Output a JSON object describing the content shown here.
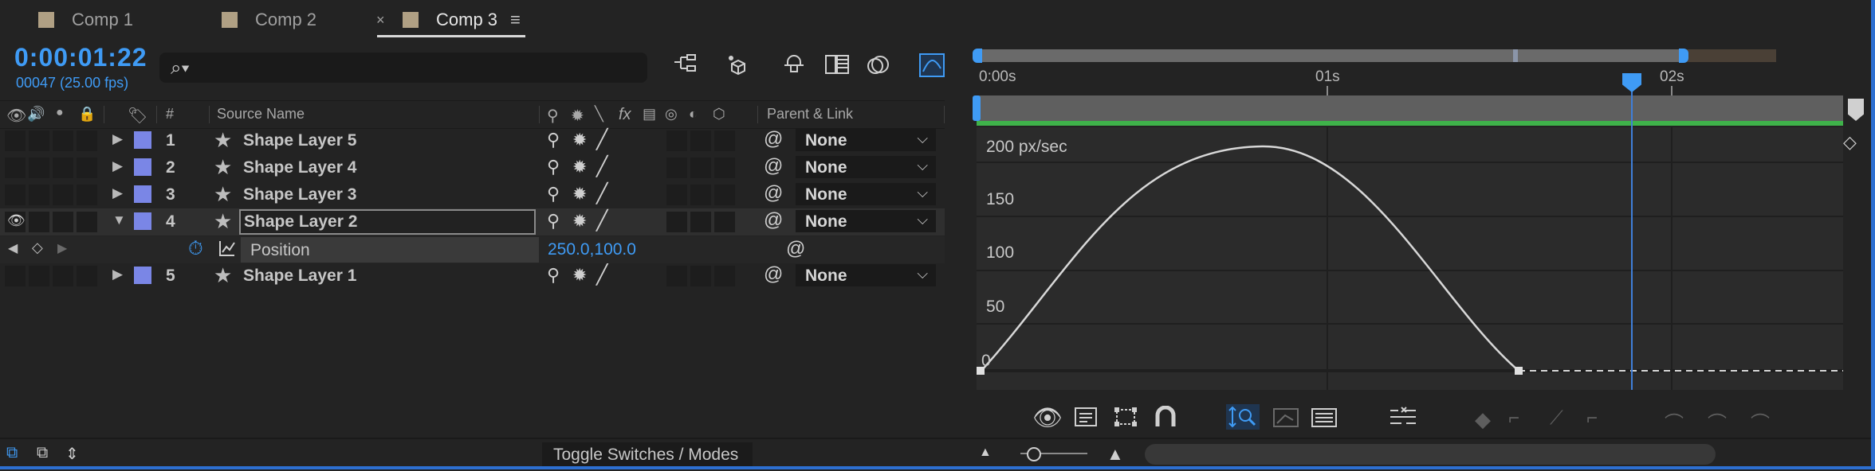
{
  "tabs": [
    {
      "label": "Comp 1",
      "active": false
    },
    {
      "label": "Comp 2",
      "active": false
    },
    {
      "label": "Comp 3",
      "active": true
    }
  ],
  "tab_close": "×",
  "tab_menu": "≡",
  "timecode": "0:00:01:22",
  "frame_info": "00047 (25.00 fps)",
  "search": {
    "icon": "search-icon",
    "glyph": "⌕▾",
    "placeholder": ""
  },
  "columns": {
    "source_name": "Source Name",
    "number": "#",
    "parent_link": "Parent & Link"
  },
  "layers": [
    {
      "num": "1",
      "name": "Shape Layer 5",
      "parent": "None",
      "expanded": false
    },
    {
      "num": "2",
      "name": "Shape Layer 4",
      "parent": "None",
      "expanded": false
    },
    {
      "num": "3",
      "name": "Shape Layer 3",
      "parent": "None",
      "expanded": false
    },
    {
      "num": "4",
      "name": "Shape Layer 2",
      "parent": "None",
      "expanded": true
    },
    {
      "num": "5",
      "name": "Shape Layer 1",
      "parent": "None",
      "expanded": false
    }
  ],
  "property": {
    "name": "Position",
    "value": "250.0,100.0"
  },
  "timeline": {
    "ticks": [
      "0:00s",
      "01s",
      "02s"
    ],
    "playhead_seconds": 1.88
  },
  "graph": {
    "unit_label": "200 px/sec",
    "y_ticks": [
      "150",
      "100",
      "50",
      "0"
    ]
  },
  "toggle_label": "Toggle Switches / Modes",
  "colors": {
    "accent": "#3f9bf5",
    "label_blue": "#7a86e6",
    "work_area": "#3fb24a"
  }
}
